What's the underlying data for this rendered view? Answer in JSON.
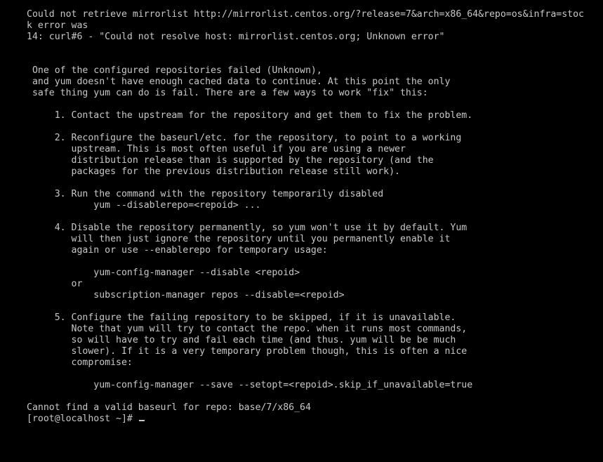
{
  "terminal": {
    "lines": [
      "Could not retrieve mirrorlist http://mirrorlist.centos.org/?release=7&arch=x86_64&repo=os&infra=stoc",
      "k error was",
      "14: curl#6 - \"Could not resolve host: mirrorlist.centos.org; Unknown error\"",
      "",
      "",
      " One of the configured repositories failed (Unknown),",
      " and yum doesn't have enough cached data to continue. At this point the only",
      " safe thing yum can do is fail. There are a few ways to work \"fix\" this:",
      "",
      "     1. Contact the upstream for the repository and get them to fix the problem.",
      "",
      "     2. Reconfigure the baseurl/etc. for the repository, to point to a working",
      "        upstream. This is most often useful if you are using a newer",
      "        distribution release than is supported by the repository (and the",
      "        packages for the previous distribution release still work).",
      "",
      "     3. Run the command with the repository temporarily disabled",
      "            yum --disablerepo=<repoid> ...",
      "",
      "     4. Disable the repository permanently, so yum won't use it by default. Yum",
      "        will then just ignore the repository until you permanently enable it",
      "        again or use --enablerepo for temporary usage:",
      "",
      "            yum-config-manager --disable <repoid>",
      "        or",
      "            subscription-manager repos --disable=<repoid>",
      "",
      "     5. Configure the failing repository to be skipped, if it is unavailable.",
      "        Note that yum will try to contact the repo. when it runs most commands,",
      "        so will have to try and fail each time (and thus. yum will be be much",
      "        slower). If it is a very temporary problem though, this is often a nice",
      "        compromise:",
      "",
      "            yum-config-manager --save --setopt=<repoid>.skip_if_unavailable=true",
      "",
      "Cannot find a valid baseurl for repo: base/7/x86_64"
    ],
    "prompt": "[root@localhost ~]# ",
    "colors": {
      "background": "#000000",
      "foreground": "#c7c7c7"
    }
  }
}
